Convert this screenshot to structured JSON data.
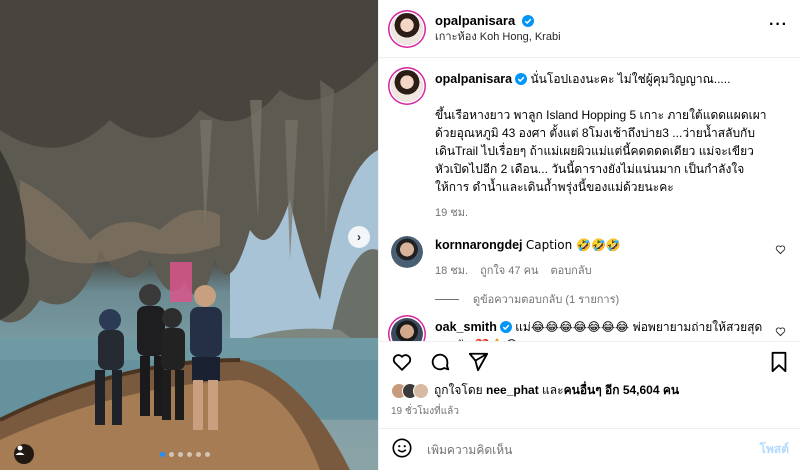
{
  "post": {
    "username": "opalpanisara",
    "location": "เกาะห้อง Koh Hong, Krabi",
    "slide_count": 6,
    "active_slide": 1
  },
  "caption": {
    "username": "opalpanisara",
    "text": "นั่นโอปเองนะคะ ไม่ใช่ผู้คุมวิญญาณ.....\n\nขึ้นเรือหางยาว พาลูก Island Hopping 5 เกาะ ภายใต้แดดแผดเผาด้วยอุณหภูมิ 43 องศา ตั้งแต่ 8โมงเช้าถึงบ่าย3 ...ว่ายน้ำสลับกับเดินTrail ไปเรื่อยๆ ถ้าแม่เผยผิวแม่แต่นี้คดดดดเดียว แม่จะเขียวหัวเปิดไปอีก 2 เดือน... วันนี้ดารางยังไม่แน่นมาก เป็นกำลังใจให้การ ดำน้ำและเดินถ้ำพรุ่งนี้ของแม่ด้วยนะคะ",
    "time": "19 ชม."
  },
  "comments": [
    {
      "username": "kornnarongdej",
      "text": "Caption 🤣🤣🤣",
      "time": "18 ชม.",
      "likes": "ถูกใจ 47 คน",
      "reply_label": "ตอบกลับ",
      "view_replies": "ดูข้อความตอบกลับ (1 รายการ)"
    },
    {
      "username": "oak_smith",
      "text": "แม่😂😂😂😂😂😂😂 พ่อพยายามถ่ายให้สวยสุดละครับ ❤️🙏😂"
    }
  ],
  "likes": {
    "prefix": "ถูกใจโดย ",
    "liked_by": "nee_phat",
    "suffix": " และ",
    "others": "คนอื่นๆ อีก 54,604 คน"
  },
  "timestamp": "19 ชั่วโมงที่แล้ว",
  "add_comment": {
    "placeholder": "เพิ่มความคิดเห็น",
    "post_label": "โพสต์"
  },
  "icons": [
    "verified-icon",
    "more-icon",
    "heart-icon",
    "comment-icon",
    "share-icon",
    "bookmark-icon",
    "emoji-icon",
    "next-icon",
    "tag-user-icon"
  ],
  "colors": {
    "verified": "#0095f6",
    "post_button": "#b3dbff",
    "secondary_text": "#737373"
  }
}
